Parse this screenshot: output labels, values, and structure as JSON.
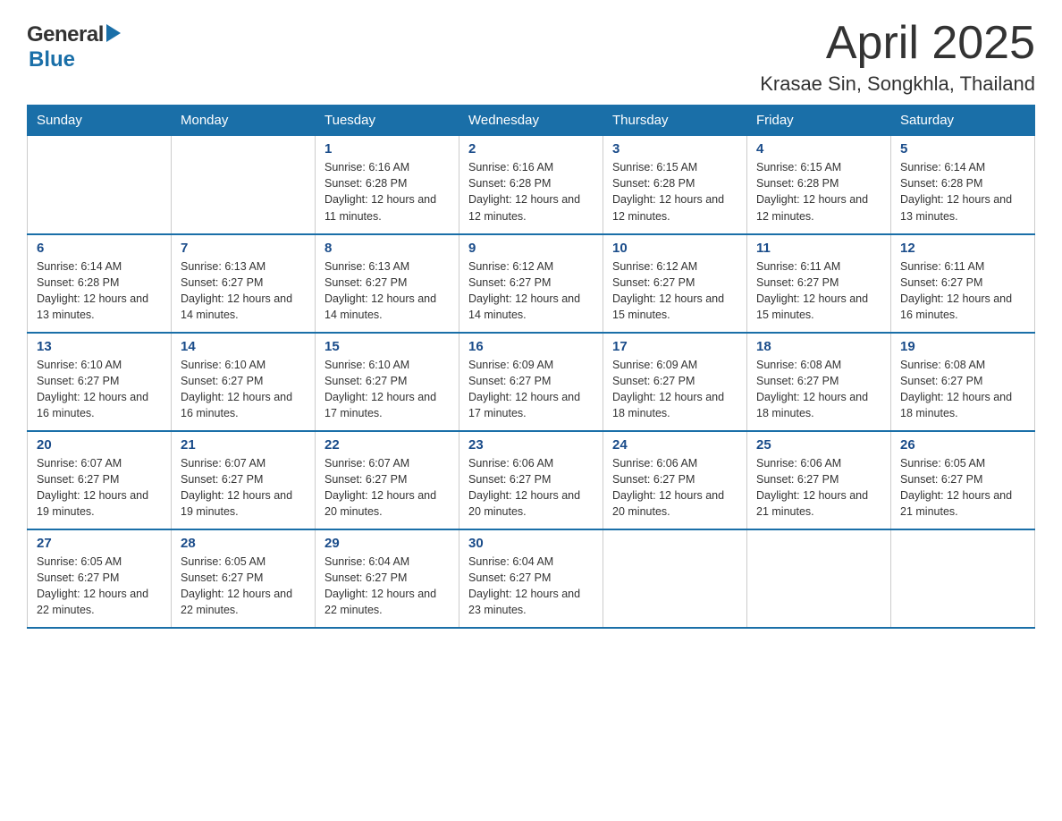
{
  "header": {
    "title": "April 2025",
    "subtitle": "Krasae Sin, Songkhla, Thailand",
    "logo_general": "General",
    "logo_blue": "Blue"
  },
  "weekdays": [
    "Sunday",
    "Monday",
    "Tuesday",
    "Wednesday",
    "Thursday",
    "Friday",
    "Saturday"
  ],
  "weeks": [
    [
      {
        "day": "",
        "sunrise": "",
        "sunset": "",
        "daylight": ""
      },
      {
        "day": "",
        "sunrise": "",
        "sunset": "",
        "daylight": ""
      },
      {
        "day": "1",
        "sunrise": "Sunrise: 6:16 AM",
        "sunset": "Sunset: 6:28 PM",
        "daylight": "Daylight: 12 hours and 11 minutes."
      },
      {
        "day": "2",
        "sunrise": "Sunrise: 6:16 AM",
        "sunset": "Sunset: 6:28 PM",
        "daylight": "Daylight: 12 hours and 12 minutes."
      },
      {
        "day": "3",
        "sunrise": "Sunrise: 6:15 AM",
        "sunset": "Sunset: 6:28 PM",
        "daylight": "Daylight: 12 hours and 12 minutes."
      },
      {
        "day": "4",
        "sunrise": "Sunrise: 6:15 AM",
        "sunset": "Sunset: 6:28 PM",
        "daylight": "Daylight: 12 hours and 12 minutes."
      },
      {
        "day": "5",
        "sunrise": "Sunrise: 6:14 AM",
        "sunset": "Sunset: 6:28 PM",
        "daylight": "Daylight: 12 hours and 13 minutes."
      }
    ],
    [
      {
        "day": "6",
        "sunrise": "Sunrise: 6:14 AM",
        "sunset": "Sunset: 6:28 PM",
        "daylight": "Daylight: 12 hours and 13 minutes."
      },
      {
        "day": "7",
        "sunrise": "Sunrise: 6:13 AM",
        "sunset": "Sunset: 6:27 PM",
        "daylight": "Daylight: 12 hours and 14 minutes."
      },
      {
        "day": "8",
        "sunrise": "Sunrise: 6:13 AM",
        "sunset": "Sunset: 6:27 PM",
        "daylight": "Daylight: 12 hours and 14 minutes."
      },
      {
        "day": "9",
        "sunrise": "Sunrise: 6:12 AM",
        "sunset": "Sunset: 6:27 PM",
        "daylight": "Daylight: 12 hours and 14 minutes."
      },
      {
        "day": "10",
        "sunrise": "Sunrise: 6:12 AM",
        "sunset": "Sunset: 6:27 PM",
        "daylight": "Daylight: 12 hours and 15 minutes."
      },
      {
        "day": "11",
        "sunrise": "Sunrise: 6:11 AM",
        "sunset": "Sunset: 6:27 PM",
        "daylight": "Daylight: 12 hours and 15 minutes."
      },
      {
        "day": "12",
        "sunrise": "Sunrise: 6:11 AM",
        "sunset": "Sunset: 6:27 PM",
        "daylight": "Daylight: 12 hours and 16 minutes."
      }
    ],
    [
      {
        "day": "13",
        "sunrise": "Sunrise: 6:10 AM",
        "sunset": "Sunset: 6:27 PM",
        "daylight": "Daylight: 12 hours and 16 minutes."
      },
      {
        "day": "14",
        "sunrise": "Sunrise: 6:10 AM",
        "sunset": "Sunset: 6:27 PM",
        "daylight": "Daylight: 12 hours and 16 minutes."
      },
      {
        "day": "15",
        "sunrise": "Sunrise: 6:10 AM",
        "sunset": "Sunset: 6:27 PM",
        "daylight": "Daylight: 12 hours and 17 minutes."
      },
      {
        "day": "16",
        "sunrise": "Sunrise: 6:09 AM",
        "sunset": "Sunset: 6:27 PM",
        "daylight": "Daylight: 12 hours and 17 minutes."
      },
      {
        "day": "17",
        "sunrise": "Sunrise: 6:09 AM",
        "sunset": "Sunset: 6:27 PM",
        "daylight": "Daylight: 12 hours and 18 minutes."
      },
      {
        "day": "18",
        "sunrise": "Sunrise: 6:08 AM",
        "sunset": "Sunset: 6:27 PM",
        "daylight": "Daylight: 12 hours and 18 minutes."
      },
      {
        "day": "19",
        "sunrise": "Sunrise: 6:08 AM",
        "sunset": "Sunset: 6:27 PM",
        "daylight": "Daylight: 12 hours and 18 minutes."
      }
    ],
    [
      {
        "day": "20",
        "sunrise": "Sunrise: 6:07 AM",
        "sunset": "Sunset: 6:27 PM",
        "daylight": "Daylight: 12 hours and 19 minutes."
      },
      {
        "day": "21",
        "sunrise": "Sunrise: 6:07 AM",
        "sunset": "Sunset: 6:27 PM",
        "daylight": "Daylight: 12 hours and 19 minutes."
      },
      {
        "day": "22",
        "sunrise": "Sunrise: 6:07 AM",
        "sunset": "Sunset: 6:27 PM",
        "daylight": "Daylight: 12 hours and 20 minutes."
      },
      {
        "day": "23",
        "sunrise": "Sunrise: 6:06 AM",
        "sunset": "Sunset: 6:27 PM",
        "daylight": "Daylight: 12 hours and 20 minutes."
      },
      {
        "day": "24",
        "sunrise": "Sunrise: 6:06 AM",
        "sunset": "Sunset: 6:27 PM",
        "daylight": "Daylight: 12 hours and 20 minutes."
      },
      {
        "day": "25",
        "sunrise": "Sunrise: 6:06 AM",
        "sunset": "Sunset: 6:27 PM",
        "daylight": "Daylight: 12 hours and 21 minutes."
      },
      {
        "day": "26",
        "sunrise": "Sunrise: 6:05 AM",
        "sunset": "Sunset: 6:27 PM",
        "daylight": "Daylight: 12 hours and 21 minutes."
      }
    ],
    [
      {
        "day": "27",
        "sunrise": "Sunrise: 6:05 AM",
        "sunset": "Sunset: 6:27 PM",
        "daylight": "Daylight: 12 hours and 22 minutes."
      },
      {
        "day": "28",
        "sunrise": "Sunrise: 6:05 AM",
        "sunset": "Sunset: 6:27 PM",
        "daylight": "Daylight: 12 hours and 22 minutes."
      },
      {
        "day": "29",
        "sunrise": "Sunrise: 6:04 AM",
        "sunset": "Sunset: 6:27 PM",
        "daylight": "Daylight: 12 hours and 22 minutes."
      },
      {
        "day": "30",
        "sunrise": "Sunrise: 6:04 AM",
        "sunset": "Sunset: 6:27 PM",
        "daylight": "Daylight: 12 hours and 23 minutes."
      },
      {
        "day": "",
        "sunrise": "",
        "sunset": "",
        "daylight": ""
      },
      {
        "day": "",
        "sunrise": "",
        "sunset": "",
        "daylight": ""
      },
      {
        "day": "",
        "sunrise": "",
        "sunset": "",
        "daylight": ""
      }
    ]
  ]
}
